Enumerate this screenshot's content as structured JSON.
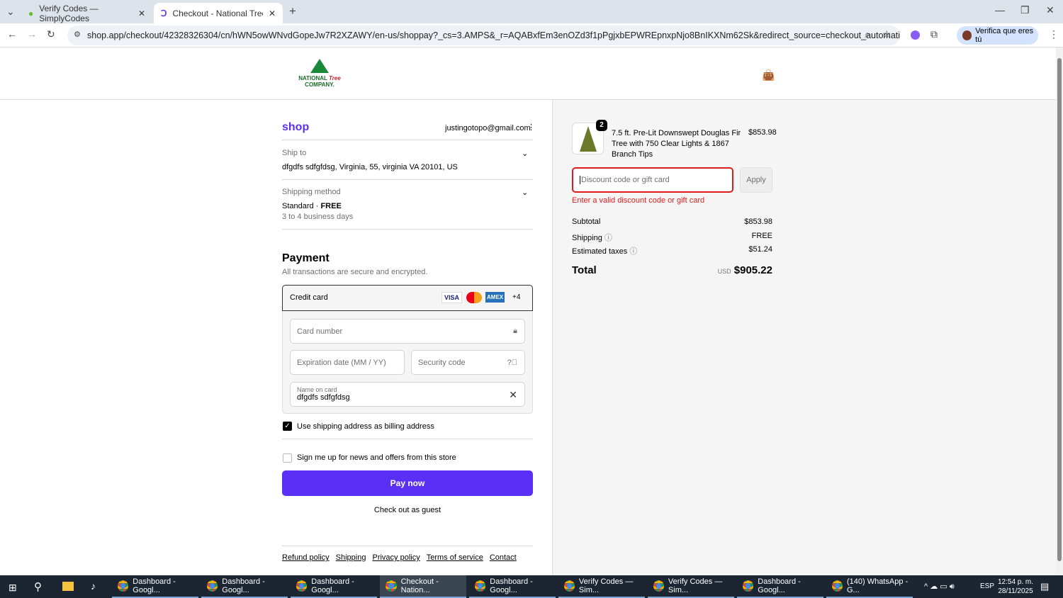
{
  "browser": {
    "tabs": [
      {
        "title": "Verify Codes — SimplyCodes"
      },
      {
        "title": "Checkout - National Tree Comp"
      }
    ],
    "url": "shop.app/checkout/42328326304/cn/hWN5owWNvdGopeJw7R2XZAWY/en-us/shoppay?_cs=3.AMPS&_r=AQABxfEm3enOZd3f1pPgjxbEPWREpnxpNjo8BnIKXNm62Sk&redirect_source=checkout_automatic_redirect&tracking...",
    "profile_label": "Verifica que eres tú"
  },
  "header": {
    "logo": "NATIONAL Tree COMPANY."
  },
  "shop": {
    "logo": "shop",
    "email": "justingotopo@gmail.com",
    "ship_to_label": "Ship to",
    "ship_to_value": "dfgdfs sdfgfdsg, Virginia, 55, virginia VA 20101, US",
    "shipping_method_label": "Shipping method",
    "shipping_method_value": "Standard",
    "shipping_method_price": "FREE",
    "shipping_method_days": "3 to 4 business days"
  },
  "payment": {
    "title": "Payment",
    "subtitle": "All transactions are secure and encrypted.",
    "method": "Credit card",
    "cards": [
      "VISA",
      "MC",
      "AMEX",
      "+4"
    ],
    "card_number_placeholder": "Card number",
    "expiry_placeholder": "Expiration date (MM / YY)",
    "security_placeholder": "Security code",
    "name_label": "Name on card",
    "name_value": "dfgdfs sdfgfdsg",
    "billing_checkbox": "Use shipping address as billing address",
    "billing_checked": true,
    "news_checkbox": "Sign me up for news and offers from this store",
    "news_checked": false,
    "pay_button": "Pay now",
    "guest_link": "Check out as guest",
    "accent": "#5a31f4"
  },
  "footer": {
    "links": [
      "Refund policy",
      "Shipping",
      "Privacy policy",
      "Terms of service",
      "Contact"
    ]
  },
  "summary": {
    "item_qty": "2",
    "item_name": "7.5 ft. Pre-Lit Downswept Douglas Fir Tree with 750 Clear Lights & 1867 Branch Tips",
    "item_price": "$853.98",
    "discount_placeholder": "Discount code or gift card",
    "apply": "Apply",
    "error": "Enter a valid discount code or gift card",
    "subtotal_label": "Subtotal",
    "subtotal": "$853.98",
    "shipping_label": "Shipping",
    "shipping": "FREE",
    "taxes_label": "Estimated taxes",
    "taxes": "$51.24",
    "total_label": "Total",
    "currency": "USD",
    "total": "$905.22"
  },
  "taskbar": {
    "items": [
      "Dashboard - Googl...",
      "Dashboard - Googl...",
      "Dashboard - Googl...",
      "Checkout - Nation...",
      "Dashboard - Googl...",
      "Verify Codes — Sim...",
      "Verify Codes — Sim...",
      "Dashboard - Googl...",
      "(140) WhatsApp - G..."
    ],
    "lang": "ESP",
    "time": "12:54 p. m.",
    "date": "28/11/2025"
  }
}
